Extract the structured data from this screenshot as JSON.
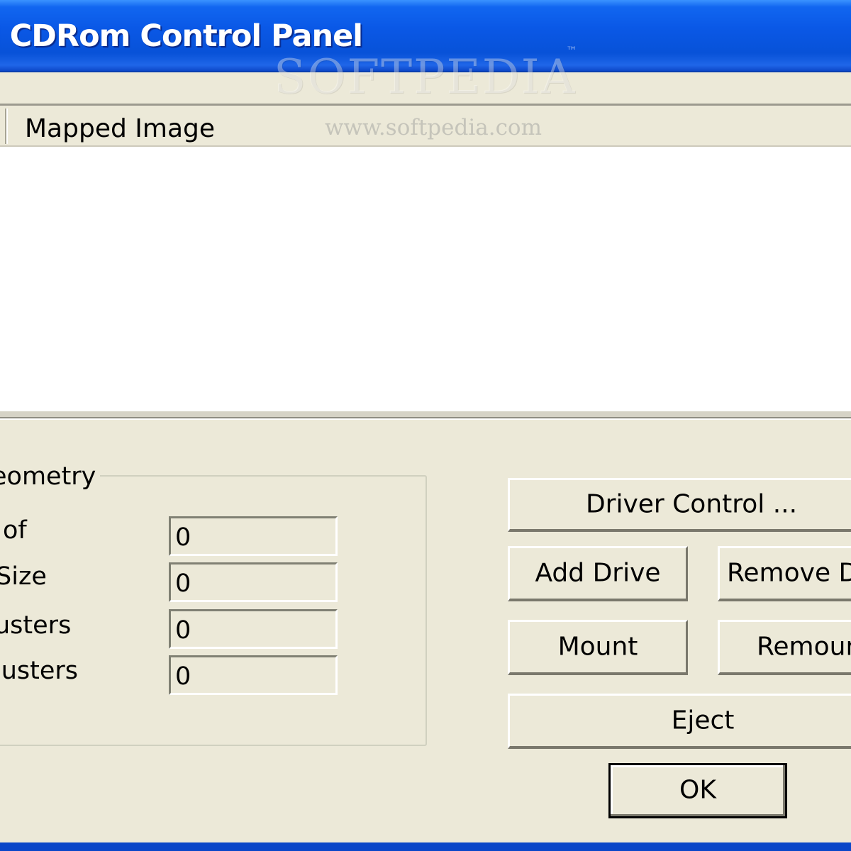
{
  "window": {
    "title": "l CDRom Control Panel"
  },
  "watermark": {
    "brand": "SOFTPEDIA",
    "tm": "™",
    "url": "www.softpedia.com"
  },
  "list": {
    "column_header": "Mapped Image",
    "rows": []
  },
  "geometry": {
    "legend": "eometry",
    "fields": [
      {
        "label": "of",
        "value": "0"
      },
      {
        "label": "Size",
        "value": "0"
      },
      {
        "label": "usters",
        "value": "0"
      },
      {
        "label": "lusters",
        "value": "0"
      }
    ]
  },
  "buttons": {
    "driver_control": "Driver Control ...",
    "add_drive": "Add Drive",
    "remove_drive": "Remove Dr",
    "mount": "Mount",
    "remount": "Remoun",
    "eject": "Eject",
    "ok": "OK"
  }
}
